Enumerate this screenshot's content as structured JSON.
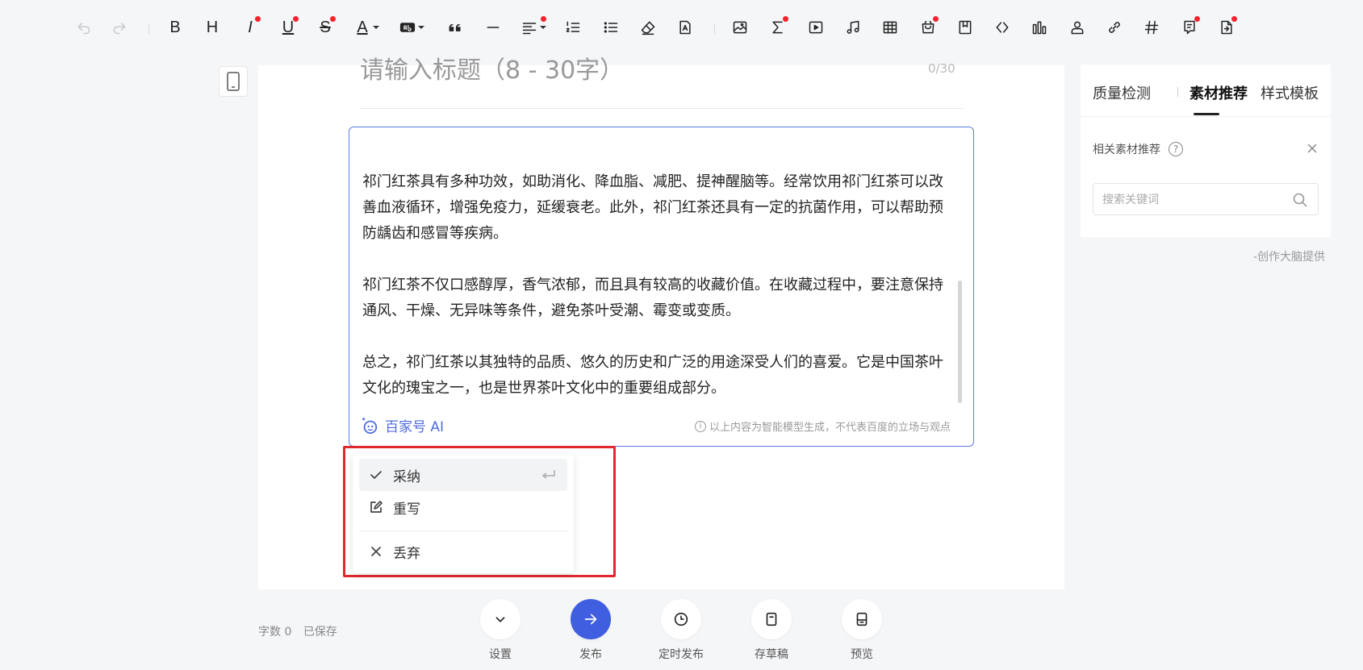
{
  "toolbar": {
    "items": [
      {
        "name": "undo-icon",
        "disabled": true
      },
      {
        "name": "redo-icon",
        "disabled": true
      },
      {
        "name": "bold-icon",
        "text": "B"
      },
      {
        "name": "heading-icon",
        "text": "H"
      },
      {
        "name": "italic-icon",
        "text": "I",
        "dot": true
      },
      {
        "name": "underline-icon",
        "text": "U",
        "dot": true
      },
      {
        "name": "strikethrough-icon",
        "text": "S",
        "dot": true
      },
      {
        "name": "font-color-icon",
        "text": "A",
        "caret": true
      },
      {
        "name": "highlight-icon",
        "caret": true
      },
      {
        "name": "quote-icon"
      },
      {
        "name": "divider-icon"
      },
      {
        "name": "align-icon",
        "caret": true,
        "dot": true
      },
      {
        "name": "ordered-list-icon"
      },
      {
        "name": "unordered-list-icon"
      },
      {
        "name": "eraser-icon"
      },
      {
        "name": "format-painter-icon"
      },
      {
        "name": "image-icon"
      },
      {
        "name": "formula-icon",
        "dot": true
      },
      {
        "name": "video-icon"
      },
      {
        "name": "audio-icon"
      },
      {
        "name": "table-icon"
      },
      {
        "name": "product-icon",
        "dot": true
      },
      {
        "name": "bookmark-icon"
      },
      {
        "name": "code-icon"
      },
      {
        "name": "chart-icon"
      },
      {
        "name": "user-icon"
      },
      {
        "name": "link-icon"
      },
      {
        "name": "hashtag-icon"
      },
      {
        "name": "vote-icon",
        "dot": true
      },
      {
        "name": "export-icon",
        "dot": true
      }
    ]
  },
  "editor": {
    "title_placeholder": "请输入标题（8 - 30字）",
    "title_counter": "0/30"
  },
  "ai_block": {
    "paragraphs": [
      "祁门红茶具有多种功效，如助消化、降血脂、减肥、提神醒脑等。经常饮用祁门红茶可以改善血液循环，增强免疫力，延缓衰老。此外，祁门红茶还具有一定的抗菌作用，可以帮助预防龋齿和感冒等疾病。",
      "祁门红茶不仅口感醇厚，香气浓郁，而且具有较高的收藏价值。在收藏过程中，要注意保持通风、干燥、无异味等条件，避免茶叶受潮、霉变或变质。",
      "总之，祁门红茶以其独特的品质、悠久的历史和广泛的用途深受人们的喜爱。它是中国茶叶文化的瑰宝之一，也是世界茶叶文化中的重要组成部分。"
    ],
    "brand": "百家号 AI",
    "disclaimer": "以上内容为智能模型生成，不代表百度的立场与观点"
  },
  "action_menu": {
    "accept": "采纳",
    "rewrite": "重写",
    "discard": "丢弃"
  },
  "right_panel": {
    "tabs": [
      "质量检测",
      "素材推荐",
      "样式模板"
    ],
    "active_tab": "素材推荐",
    "section_label": "相关素材推荐",
    "search_placeholder": "搜索关键词",
    "provider": "-创作大脑提供"
  },
  "bottom_bar": {
    "word_count": "字数 0",
    "save_status": "已保存",
    "buttons": {
      "settings": "设置",
      "publish": "发布",
      "schedule": "定时发布",
      "draft": "存草稿",
      "preview": "预览"
    }
  },
  "colors": {
    "accent": "#3f5fe0",
    "highlight_border": "#e0282e",
    "notify_dot": "#f5222d"
  }
}
